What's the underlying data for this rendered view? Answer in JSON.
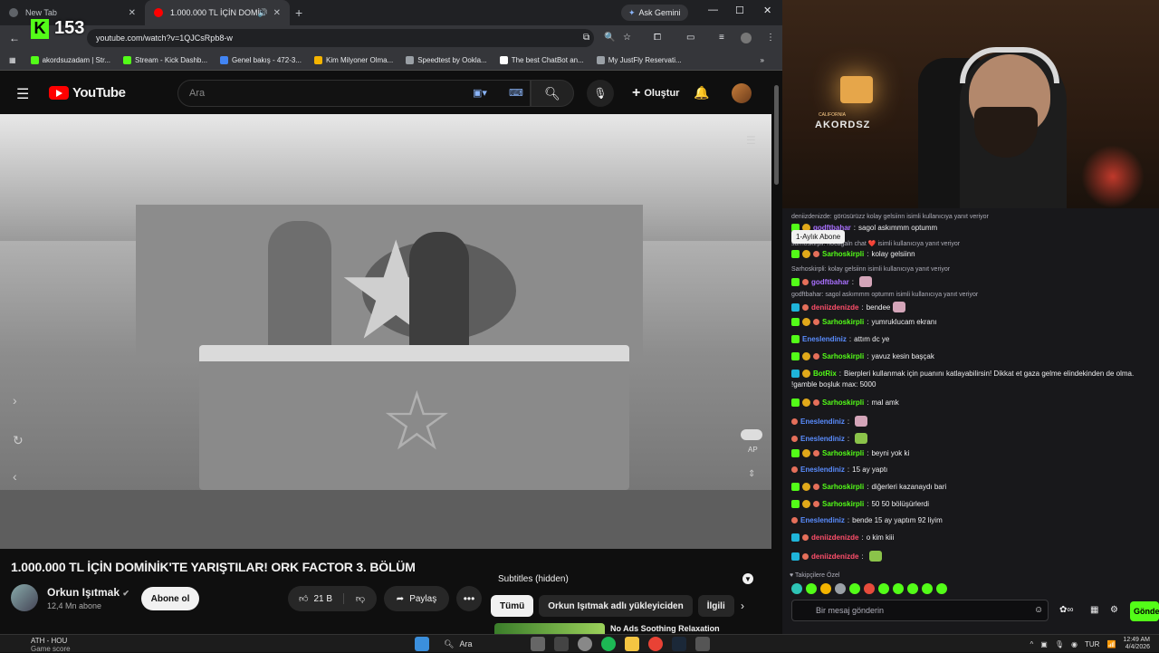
{
  "browser": {
    "tabs": [
      {
        "title": "New Tab",
        "fav_color": "#5f6368"
      },
      {
        "title": "1.000.000 TL İÇİN DOMİNİ",
        "fav_color": "#ff0000"
      }
    ],
    "gemini_label": "Ask Gemini",
    "url": "youtube.com/watch?v=1QJCsRpb8-w",
    "kick_count": "153",
    "bookmarks": [
      {
        "label": "akordsuzadam | Str...",
        "color": "#53fc18"
      },
      {
        "label": "Stream - Kick Dashb...",
        "color": "#53fc18"
      },
      {
        "label": "Genel bakış - 472-3...",
        "color": "#4285f4"
      },
      {
        "label": "Kim Milyoner Olma...",
        "color": "#f4b400"
      },
      {
        "label": "Speedtest by Ookla...",
        "color": "#9aa0a6"
      },
      {
        "label": "The best ChatBot an...",
        "color": "#ffffff"
      },
      {
        "label": "My JustFly Reservati...",
        "color": "#9aa0a6"
      }
    ]
  },
  "youtube": {
    "logo_text": "YouTube",
    "search_placeholder": "Ara",
    "create_label": "Oluştur",
    "video": {
      "title": "1.000.000 TL İÇİN DOMİNİK'TE YARIŞTILAR! ORK FACTOR 3. BÖLÜM",
      "channel": "Orkun Işıtmak",
      "subscribers": "12,4 Mn abone",
      "subscribe_label": "Abone ol",
      "likes": "21 B",
      "share_label": "Paylaş",
      "autoplay_label": "AP"
    },
    "subtitles_label": "Subtitles (hidden)",
    "chips": [
      "Tümü",
      "Orkun Işıtmak adlı yükleyiciden",
      "İlgili"
    ],
    "rec_title": "No Ads Soothing Relaxation"
  },
  "chat": {
    "tooltip": "1-Aylık Abone",
    "messages": [
      {
        "type": "reply",
        "text": "deniizdenizde: görüsürüzz kolay gelsiinn isimli kullanıcıya yanıt veriyor"
      },
      {
        "type": "msg",
        "badges": [
          "sub",
          "lvl"
        ],
        "user": "godftbahar",
        "color": "#a970ff",
        "text": "sagol askımmm optumm"
      },
      {
        "type": "reply",
        "text": "sarhoskirpli: hocagaln chat ❤️ isimli kullanıcıya yanıt veriyor"
      },
      {
        "type": "msg",
        "badges": [
          "sub",
          "lvl",
          "crown"
        ],
        "user": "Sarhoskirpli",
        "color": "#53fc18",
        "text": "kolay gelsiinn"
      },
      {
        "type": "reply",
        "text": "Sarhoskirpli: kolay gelsiinn isimli kullanıcıya yanıt veriyor"
      },
      {
        "type": "msg",
        "badges": [
          "sub",
          "crown"
        ],
        "user": "godftbahar",
        "color": "#a970ff",
        "text": "",
        "emote": "pink"
      },
      {
        "type": "reply",
        "text": "godftbahar: sagol askımmm optumm isimli kullanıcıya yanıt veriyor"
      },
      {
        "type": "msg",
        "badges": [
          "kick",
          "crown"
        ],
        "user": "deniizdenizde",
        "color": "#ff4f6b",
        "text": "bendee",
        "emote": "pink"
      },
      {
        "type": "msg",
        "badges": [
          "sub",
          "lvl",
          "crown"
        ],
        "user": "Sarhoskirpli",
        "color": "#53fc18",
        "text": "yumruklucam ekranı"
      },
      {
        "type": "msg",
        "badges": [
          "sub"
        ],
        "user": "Eneslendiniz",
        "color": "#5a8dff",
        "text": "attım dc ye"
      },
      {
        "type": "msg",
        "badges": [
          "sub",
          "lvl",
          "crown"
        ],
        "user": "Sarhoskirpli",
        "color": "#53fc18",
        "text": "yavuz kesin başçak"
      },
      {
        "type": "msg",
        "badges": [
          "kick",
          "lvl"
        ],
        "user": "BotRix",
        "color": "#53fc18",
        "text": "Bierpleri kullanmak için puanını katlayabilirsin! Dikkat et gaza gelme elindekinden de olma."
      },
      {
        "type": "cont",
        "text": "!gamble boşluk max: 5000"
      },
      {
        "type": "msg",
        "badges": [
          "sub",
          "lvl",
          "crown"
        ],
        "user": "Sarhoskirpli",
        "color": "#53fc18",
        "text": "mal amk"
      },
      {
        "type": "msg",
        "badges": [
          "crown"
        ],
        "user": "Eneslendiniz",
        "color": "#5a8dff",
        "text": "",
        "emote": "pink"
      },
      {
        "type": "msg",
        "badges": [
          "crown"
        ],
        "user": "Eneslendiniz",
        "color": "#5a8dff",
        "text": "",
        "emote": "green"
      },
      {
        "type": "msg",
        "badges": [
          "sub",
          "lvl",
          "crown"
        ],
        "user": "Sarhoskirpli",
        "color": "#53fc18",
        "text": "beyni yok ki"
      },
      {
        "type": "msg",
        "badges": [
          "crown"
        ],
        "user": "Eneslendiniz",
        "color": "#5a8dff",
        "text": "15 ay yaptı"
      },
      {
        "type": "msg",
        "badges": [
          "sub",
          "lvl",
          "crown"
        ],
        "user": "Sarhoskirpli",
        "color": "#53fc18",
        "text": "diğerleri kazanaydı bari"
      },
      {
        "type": "msg",
        "badges": [
          "sub",
          "lvl",
          "crown"
        ],
        "user": "Sarhoskirpli",
        "color": "#53fc18",
        "text": "50 50 bölüşürlerdi"
      },
      {
        "type": "msg",
        "badges": [
          "crown"
        ],
        "user": "Eneslendiniz",
        "color": "#5a8dff",
        "text": "bende 15 ay yaptım 92 liyim"
      },
      {
        "type": "msg",
        "badges": [
          "kick",
          "crown"
        ],
        "user": "deniizdenizde",
        "color": "#ff4f6b",
        "text": "o kim kiii"
      },
      {
        "type": "msg",
        "badges": [
          "kick",
          "crown"
        ],
        "user": "deniizdenizde",
        "color": "#ff4f6b",
        "text": "",
        "emote": "green"
      }
    ],
    "followers_label": "Takipçilere Özel",
    "input_placeholder": "Bir mesaj gönderin",
    "send_label": "Gönder"
  },
  "stream_sign": "AKORDSZ",
  "stream_sign_small": "CALIFORNIA",
  "taskbar": {
    "weather_line1": "ATH - HOU",
    "weather_line2": "Game score",
    "search_label": "Ara",
    "lang": "TUR",
    "time": "12:49 AM",
    "date": "4/4/2026"
  }
}
